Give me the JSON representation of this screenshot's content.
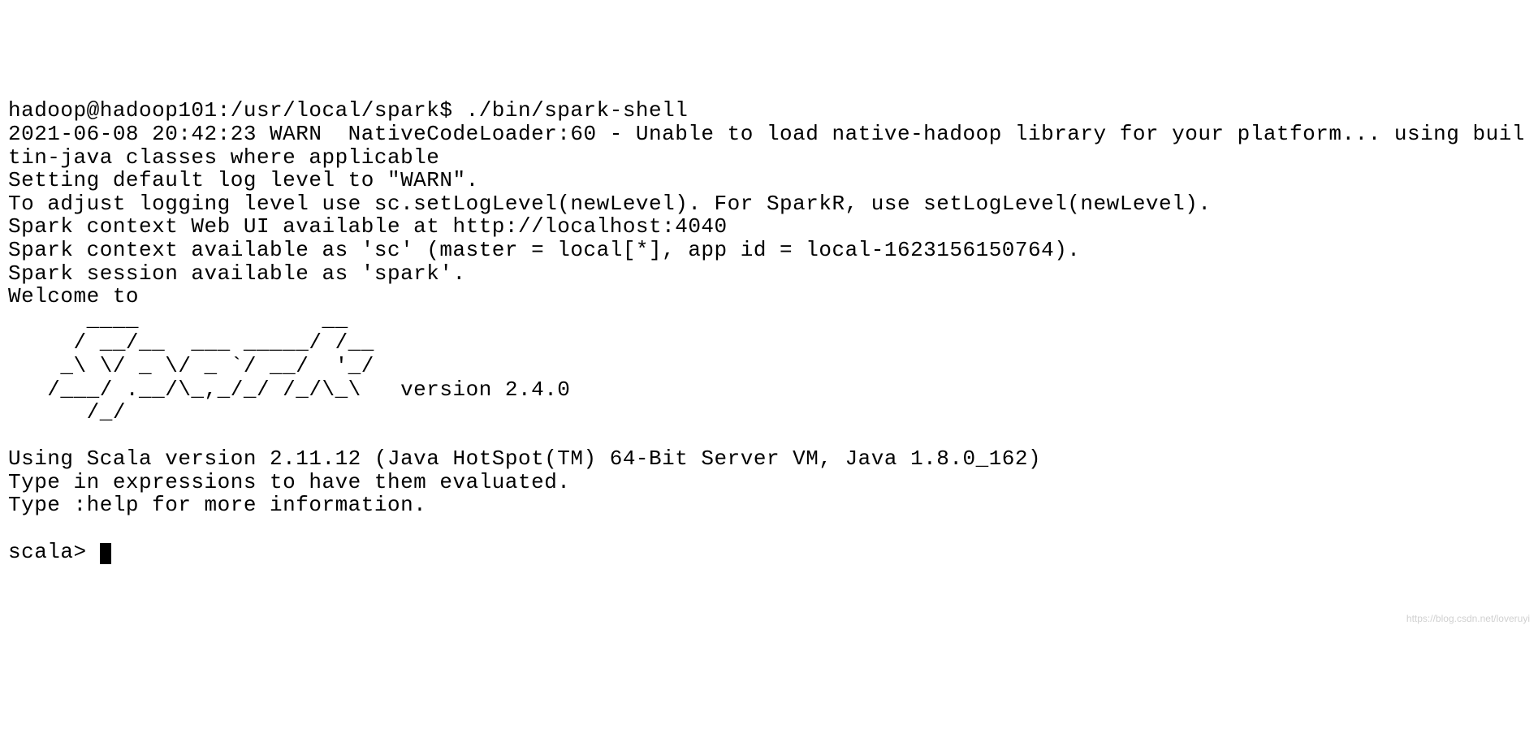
{
  "prompt_line": "hadoop@hadoop101:/usr/local/spark$ ./bin/spark-shell",
  "warn_line": "2021-06-08 20:42:23 WARN  NativeCodeLoader:60 - Unable to load native-hadoop library for your platform... using builtin-java classes where applicable",
  "log_level_line": "Setting default log level to \"WARN\".",
  "adjust_log_line": "To adjust logging level use sc.setLogLevel(newLevel). For SparkR, use setLogLevel(newLevel).",
  "web_ui_line": "Spark context Web UI available at http://localhost:4040",
  "context_line": "Spark context available as 'sc' (master = local[*], app id = local-1623156150764).",
  "session_line": "Spark session available as 'spark'.",
  "welcome_line": "Welcome to",
  "ascii_art": "      ____              __\n     / __/__  ___ _____/ /__\n    _\\ \\/ _ \\/ _ `/ __/  '_/\n   /___/ .__/\\_,_/_/ /_/\\_\\   version 2.4.0\n      /_/",
  "scala_version_line": "Using Scala version 2.11.12 (Java HotSpot(TM) 64-Bit Server VM, Java 1.8.0_162)",
  "type_expr_line": "Type in expressions to have them evaluated.",
  "help_line": "Type :help for more information.",
  "scala_prompt": "scala> ",
  "watermark": "https://blog.csdn.net/loveruyi"
}
